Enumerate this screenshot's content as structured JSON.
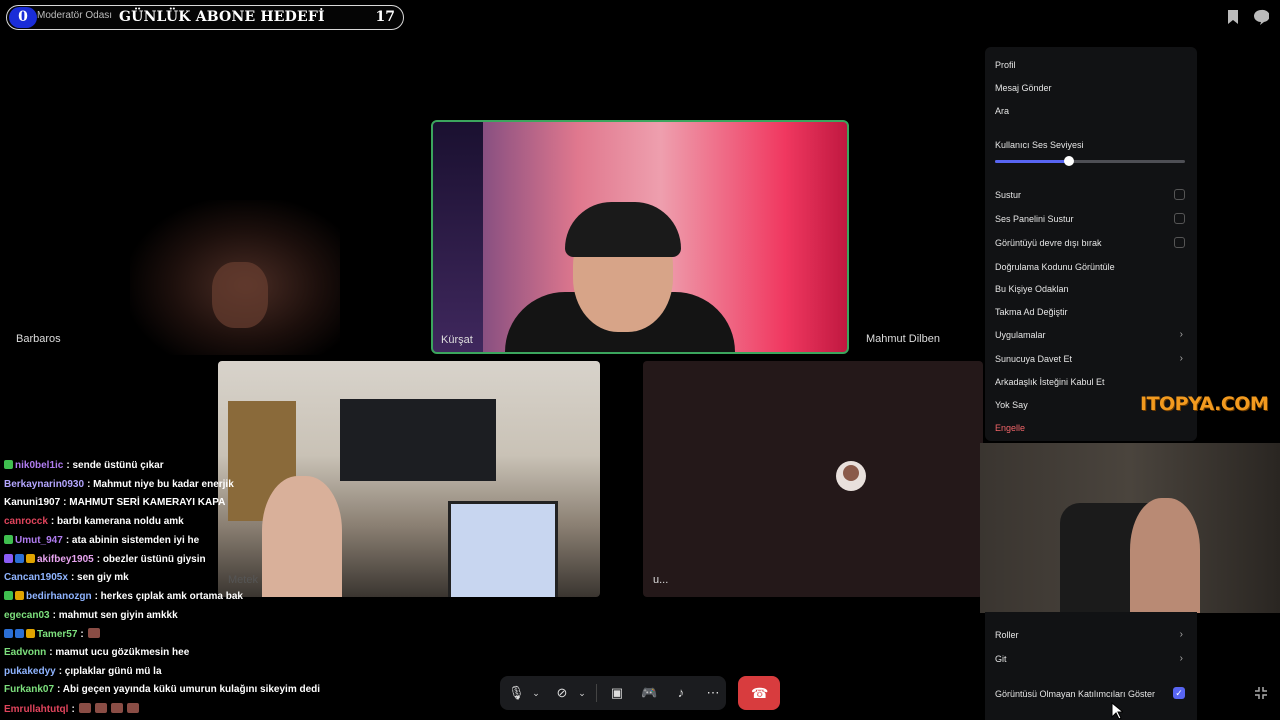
{
  "goal": {
    "count": "0",
    "subtitle": "Moderatör Odası",
    "title": "GÜNLÜK ABONE HEDEFİ",
    "target": "17"
  },
  "tiles": {
    "barbaros": "Barbaros",
    "kursat": "Kürşat",
    "mahmut": "Mahmut Dilben",
    "metek": "Metek",
    "u": "u..."
  },
  "menu": {
    "items": [
      "Profil",
      "Mesaj Gönder",
      "Ara"
    ],
    "volume_label": "Kullanıcı Ses Seviyesi",
    "volume_level": 0.39,
    "checks": [
      "Sustur",
      "Ses Panelini Sustur",
      "Görüntüyü devre dışı bırak"
    ],
    "items2": [
      "Doğrulama Kodunu Görüntüle",
      "Bu Kişiye Odaklan",
      "Takma Ad Değiştir"
    ],
    "submenus": [
      "Uygulamalar",
      "Sunucuya Davet Et"
    ],
    "items3": [
      "Arkadaşlık İsteğini Kabul Et",
      "Yok Say"
    ],
    "danger": "Engelle",
    "bottom_submenus": [
      "Roller",
      "Git"
    ],
    "show_nonvideo": "Görüntüsü Olmayan Katılımcıları Göster"
  },
  "watermark": "ITOPYA.COM",
  "chat": [
    {
      "user": "nik0bel1ic",
      "color": "#b07cf0",
      "msg": ": sende üstünü çıkar"
    },
    {
      "user": "Berkaynarin0930",
      "color": "#b4a6ff",
      "msg": ": Mahmut niye bu kadar enerjik"
    },
    {
      "user": "Kanuni1907",
      "color": "#ffffff",
      "msg": ": MAHMUT SERİ KAMERAYI KAPA"
    },
    {
      "user": "canrocck",
      "color": "#e0445c",
      "msg": ": barbı kamerana noldu amk"
    },
    {
      "user": "Umut_947",
      "color": "#b07cf0",
      "msg": ": ata abinin sistemden iyi he"
    },
    {
      "user": "akifbey1905",
      "color": "#e8a4f0",
      "msg": ": obezler üstünü giysin"
    },
    {
      "user": "Cancan1905x",
      "color": "#8fb4ff",
      "msg": ": sen giy mk"
    },
    {
      "user": "bedirhanozgn",
      "color": "#8fb4ff",
      "msg": ": herkes çıplak amk ortama bak"
    },
    {
      "user": "egecan03",
      "color": "#7de07d",
      "msg": ": mahmut sen giyin amkkk"
    },
    {
      "user": "Tamer57",
      "color": "#7de07d",
      "msg": ":"
    },
    {
      "user": "Eadvonn",
      "color": "#7de07d",
      "msg": ": mamut ucu gözükmesin hee"
    },
    {
      "user": "pukakedyy",
      "color": "#8fb4ff",
      "msg": ": çıplaklar günü mü la"
    },
    {
      "user": "Furkank07",
      "color": "#7de07d",
      "msg": ": Abi geçen yayında kükü umurun kulağını sikeyim dedi"
    },
    {
      "user": "Emrullahtutql",
      "color": "#e0445c",
      "msg": ":"
    }
  ]
}
